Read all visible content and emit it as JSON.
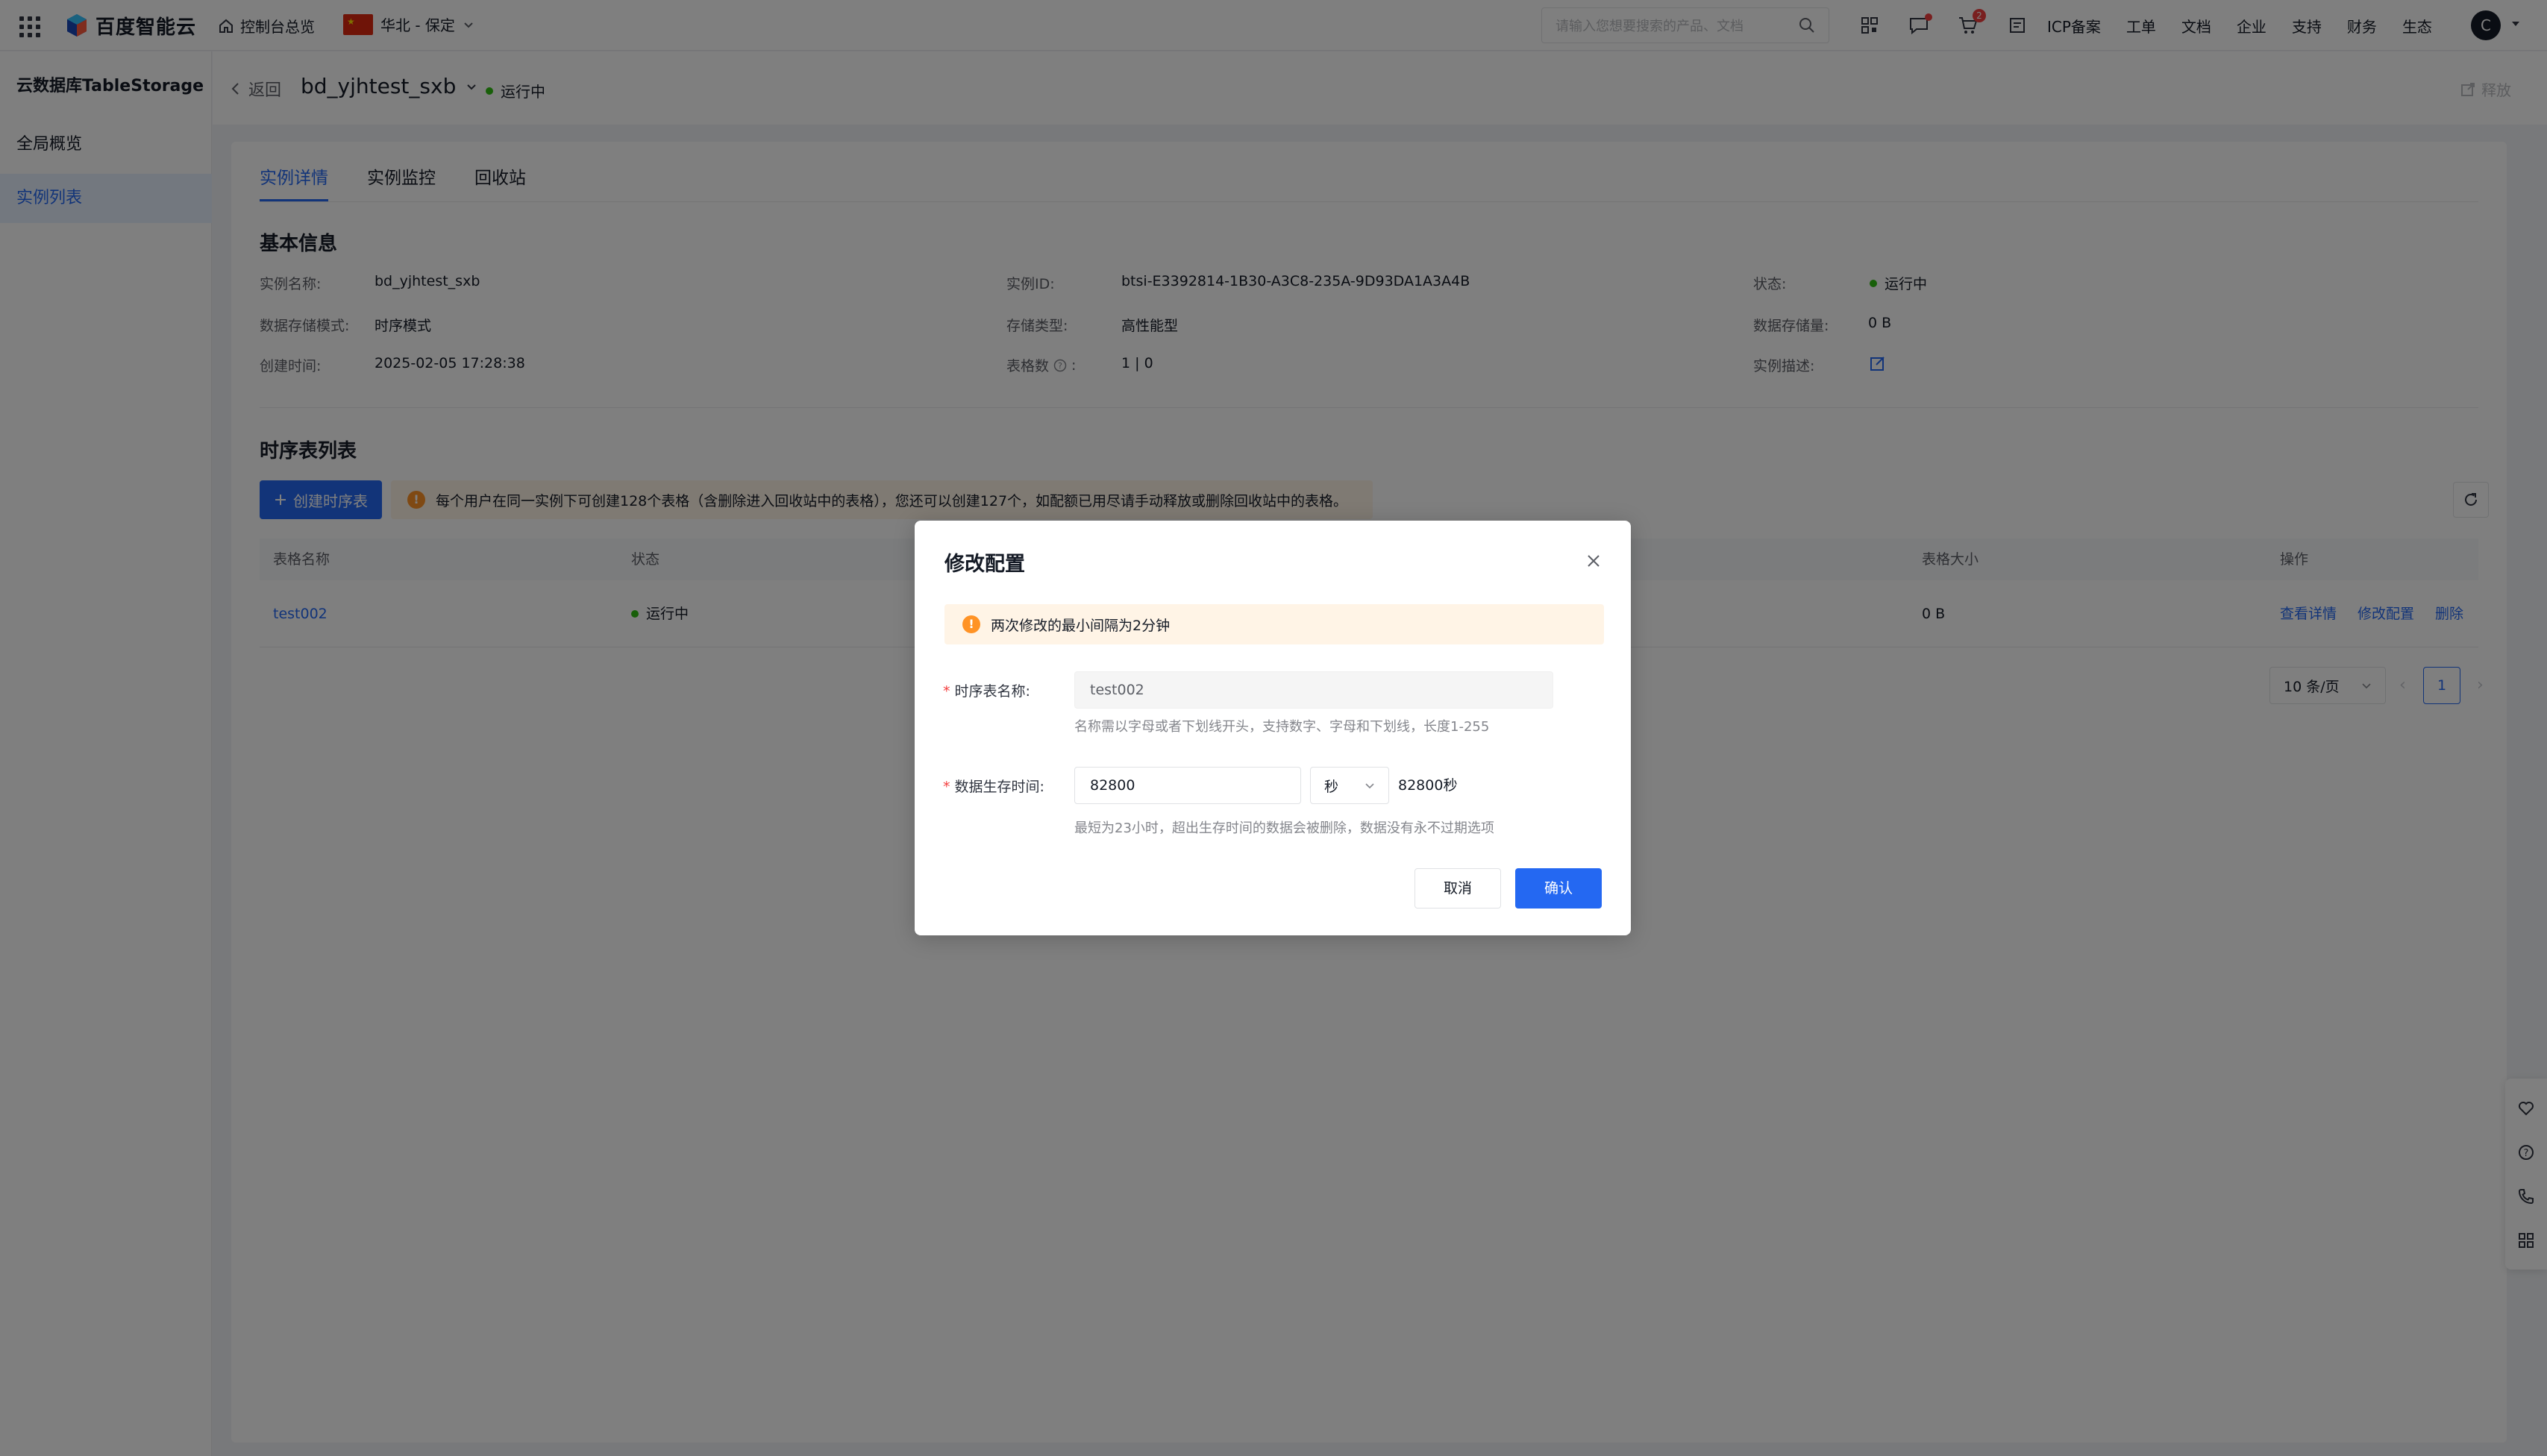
{
  "colors": {
    "primary": "#2468f2",
    "success": "#30bf13",
    "warning": "#ff9326",
    "danger": "#f33e3e"
  },
  "topnav": {
    "brand": "百度智能云",
    "console_home": "控制台总览",
    "region": "华北 - 保定",
    "search_placeholder": "请输入您想要搜索的产品、文档",
    "cart_badge": "2",
    "links": [
      "ICP备案",
      "工单",
      "文档",
      "企业",
      "支持",
      "财务",
      "生态"
    ],
    "avatar": "C"
  },
  "sidebar": {
    "title": "云数据库TableStorage",
    "items": [
      {
        "label": "全局概览",
        "active": false
      },
      {
        "label": "实例列表",
        "active": true
      }
    ]
  },
  "header": {
    "back": "返回",
    "instance_name": "bd_yjhtest_sxb",
    "status": "运行中",
    "release": "释放"
  },
  "tabs": [
    {
      "label": "实例详情",
      "active": true
    },
    {
      "label": "实例监控",
      "active": false
    },
    {
      "label": "回收站",
      "active": false
    }
  ],
  "basic_info": {
    "title": "基本信息",
    "fields": [
      {
        "label": "实例名称:",
        "value": "bd_yjhtest_sxb"
      },
      {
        "label": "实例ID:",
        "value": "btsi-E3392814-1B30-A3C8-235A-9D93DA1A3A4B"
      },
      {
        "label": "状态:",
        "value": "运行中"
      },
      {
        "label": "数据存储模式:",
        "value": "时序模式"
      },
      {
        "label": "存储类型:",
        "value": "高性能型"
      },
      {
        "label": "数据存储量:",
        "value": "0 B"
      },
      {
        "label": "创建时间:",
        "value": "2025-02-05 17:28:38"
      },
      {
        "label": "表格数",
        "value": "1 | 0"
      },
      {
        "label": "实例描述:",
        "value": ""
      }
    ]
  },
  "table_section": {
    "title": "时序表列表",
    "create_button": "创建时序表",
    "notice": "每个用户在同一实例下可创建128个表格（含删除进入回收站中的表格），您还可以创建127个，如配额已用尽请手动释放或删除回收站中的表格。",
    "columns": [
      "表格名称",
      "状态",
      "表格大小",
      "操作"
    ],
    "rows": [
      {
        "name": "test002",
        "status": "运行中",
        "size": "0 B",
        "actions": [
          "查看详情",
          "修改配置",
          "删除"
        ]
      }
    ],
    "page_size": "10 条/页",
    "current_page": "1"
  },
  "modal": {
    "title": "修改配置",
    "alert": "两次修改的最小间隔为2分钟",
    "table_name_label": "时序表名称:",
    "table_name_value": "test002",
    "table_name_hint": "名称需以字母或者下划线开头，支持数字、字母和下划线，长度1-255",
    "ttl_label": "数据生存时间:",
    "ttl_value": "82800",
    "ttl_unit": "秒",
    "ttl_converted": "82800秒",
    "ttl_hint": "最短为23小时，超出生存时间的数据会被删除，数据没有永不过期选项",
    "cancel": "取消",
    "confirm": "确认"
  }
}
